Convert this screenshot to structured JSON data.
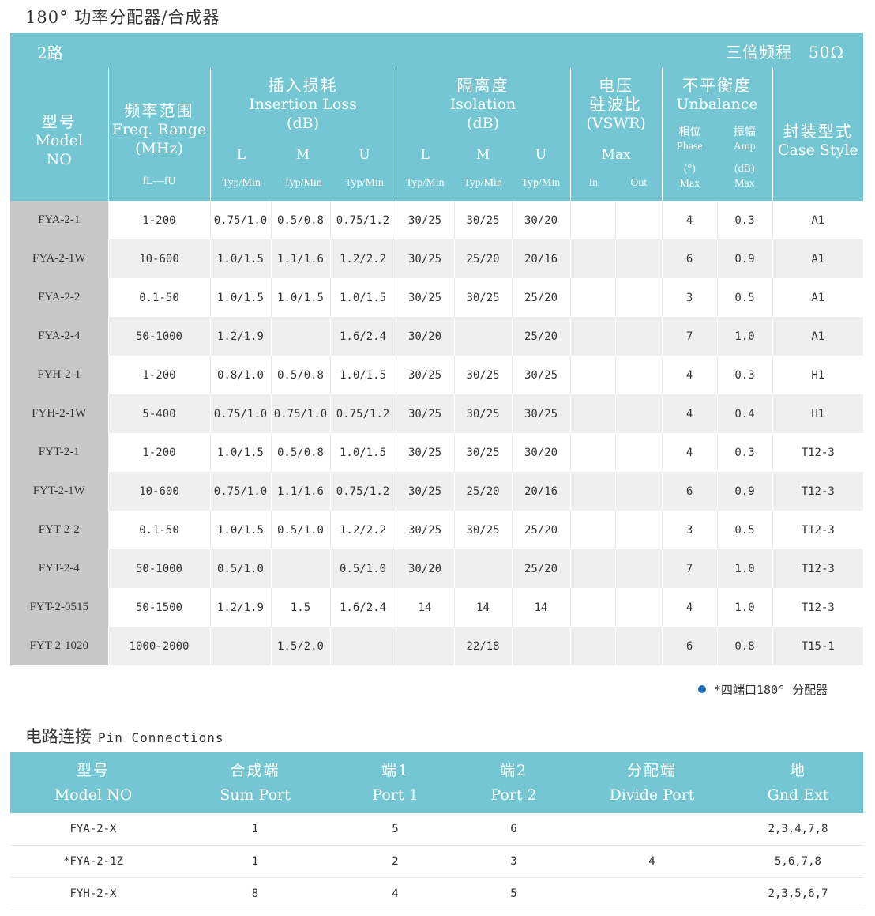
{
  "page_title": "180° 功率分配器/合成器",
  "banner": {
    "left": "2路",
    "right": "三倍频程　50Ω"
  },
  "spec_header": {
    "model": {
      "cn": "型号",
      "en1": "Model",
      "en2": "NO"
    },
    "freq": {
      "cn": "频率范围",
      "en1": "Freq. Range",
      "en2": "(MHz)",
      "sub": "fL—fU"
    },
    "insertion": {
      "cn": "插入损耗",
      "en1": "Insertion Loss",
      "en2": "(dB)",
      "cols": [
        "L",
        "M",
        "U"
      ],
      "sub": [
        "Typ/Min",
        "Typ/Min",
        "Typ/Min"
      ]
    },
    "isolation": {
      "cn": "隔离度",
      "en1": "Isolation",
      "en2": "(dB)",
      "cols": [
        "L",
        "M",
        "U"
      ],
      "sub": [
        "Typ/Min",
        "Typ/Min",
        "Typ/Min"
      ]
    },
    "vswr": {
      "cn1": "电压",
      "cn2": "驻波比",
      "en": "(VSWR)",
      "max": "Max",
      "sub": [
        "In",
        "Out"
      ]
    },
    "unbalance": {
      "cn": "不平衡度",
      "en": "Unbalance",
      "phase_cn": "相位",
      "phase_en": "Phase",
      "phase_unit": "(°)",
      "amp_cn": "振幅",
      "amp_en": "Amp",
      "amp_unit": "(dB)",
      "max": "Max"
    },
    "case": {
      "cn": "封装型式",
      "en": "Case Style"
    }
  },
  "spec_rows": [
    [
      "FYA-2-1",
      "1-200",
      "0.75/1.0",
      "0.5/0.8",
      "0.75/1.2",
      "30/25",
      "30/25",
      "30/20",
      "",
      "",
      "4",
      "0.3",
      "A1"
    ],
    [
      "FYA-2-1W",
      "10-600",
      "1.0/1.5",
      "1.1/1.6",
      "1.2/2.2",
      "30/25",
      "25/20",
      "20/16",
      "",
      "",
      "6",
      "0.9",
      "A1"
    ],
    [
      "FYA-2-2",
      "0.1-50",
      "1.0/1.5",
      "1.0/1.5",
      "1.0/1.5",
      "30/25",
      "30/25",
      "25/20",
      "",
      "",
      "3",
      "0.5",
      "A1"
    ],
    [
      "FYA-2-4",
      "50-1000",
      "1.2/1.9",
      "",
      "1.6/2.4",
      "30/20",
      "",
      "25/20",
      "",
      "",
      "7",
      "1.0",
      "A1"
    ],
    [
      "FYH-2-1",
      "1-200",
      "0.8/1.0",
      "0.5/0.8",
      "1.0/1.5",
      "30/25",
      "30/25",
      "30/25",
      "",
      "",
      "4",
      "0.3",
      "H1"
    ],
    [
      "FYH-2-1W",
      "5-400",
      "0.75/1.0",
      "0.75/1.0",
      "0.75/1.2",
      "30/25",
      "30/25",
      "30/25",
      "",
      "",
      "4",
      "0.4",
      "H1"
    ],
    [
      "FYT-2-1",
      "1-200",
      "1.0/1.5",
      "0.5/0.8",
      "1.0/1.5",
      "30/25",
      "30/25",
      "30/20",
      "",
      "",
      "4",
      "0.3",
      "T12-3"
    ],
    [
      "FYT-2-1W",
      "10-600",
      "0.75/1.0",
      "1.1/1.6",
      "0.75/1.2",
      "30/25",
      "25/20",
      "20/16",
      "",
      "",
      "6",
      "0.9",
      "T12-3"
    ],
    [
      "FYT-2-2",
      "0.1-50",
      "1.0/1.5",
      "0.5/1.0",
      "1.2/2.2",
      "30/25",
      "30/25",
      "25/20",
      "",
      "",
      "3",
      "0.5",
      "T12-3"
    ],
    [
      "FYT-2-4",
      "50-1000",
      "0.5/1.0",
      "",
      "0.5/1.0",
      "30/20",
      "",
      "25/20",
      "",
      "",
      "7",
      "1.0",
      "T12-3"
    ],
    [
      "FYT-2-0515",
      "50-1500",
      "1.2/1.9",
      "1.5",
      "1.6/2.4",
      "14",
      "14",
      "14",
      "",
      "",
      "4",
      "1.0",
      "T12-3"
    ],
    [
      "FYT-2-1020",
      "1000-2000",
      "",
      "1.5/2.0",
      "",
      "",
      "22/18",
      "",
      "",
      "",
      "6",
      "0.8",
      "T15-1"
    ]
  ],
  "note": "*四端口180° 分配器",
  "pin_title": {
    "cn": "电路连接",
    "en": "Pin Connections"
  },
  "pin_header": [
    {
      "cn": "型号",
      "en": "Model NO"
    },
    {
      "cn": "合成端",
      "en": "Sum Port"
    },
    {
      "cn": "端1",
      "en": "Port 1"
    },
    {
      "cn": "端2",
      "en": "Port 2"
    },
    {
      "cn": "分配端",
      "en": "Divide Port"
    },
    {
      "cn": "地",
      "en": "Gnd Ext"
    }
  ],
  "pin_rows": [
    [
      "FYA-2-X",
      "1",
      "5",
      "6",
      "",
      "2,3,4,7,8"
    ],
    [
      "*FYA-2-1Z",
      "1",
      "2",
      "3",
      "4",
      "5,6,7,8"
    ],
    [
      "FYH-2-X",
      "8",
      "4",
      "5",
      "",
      "2,3,5,6,7"
    ]
  ],
  "colors": {
    "header_bg": "#74c6d3",
    "model_col_bg": "#c8c8c8",
    "stripe": "#efefef",
    "note_dot": "#1f6fb5"
  }
}
